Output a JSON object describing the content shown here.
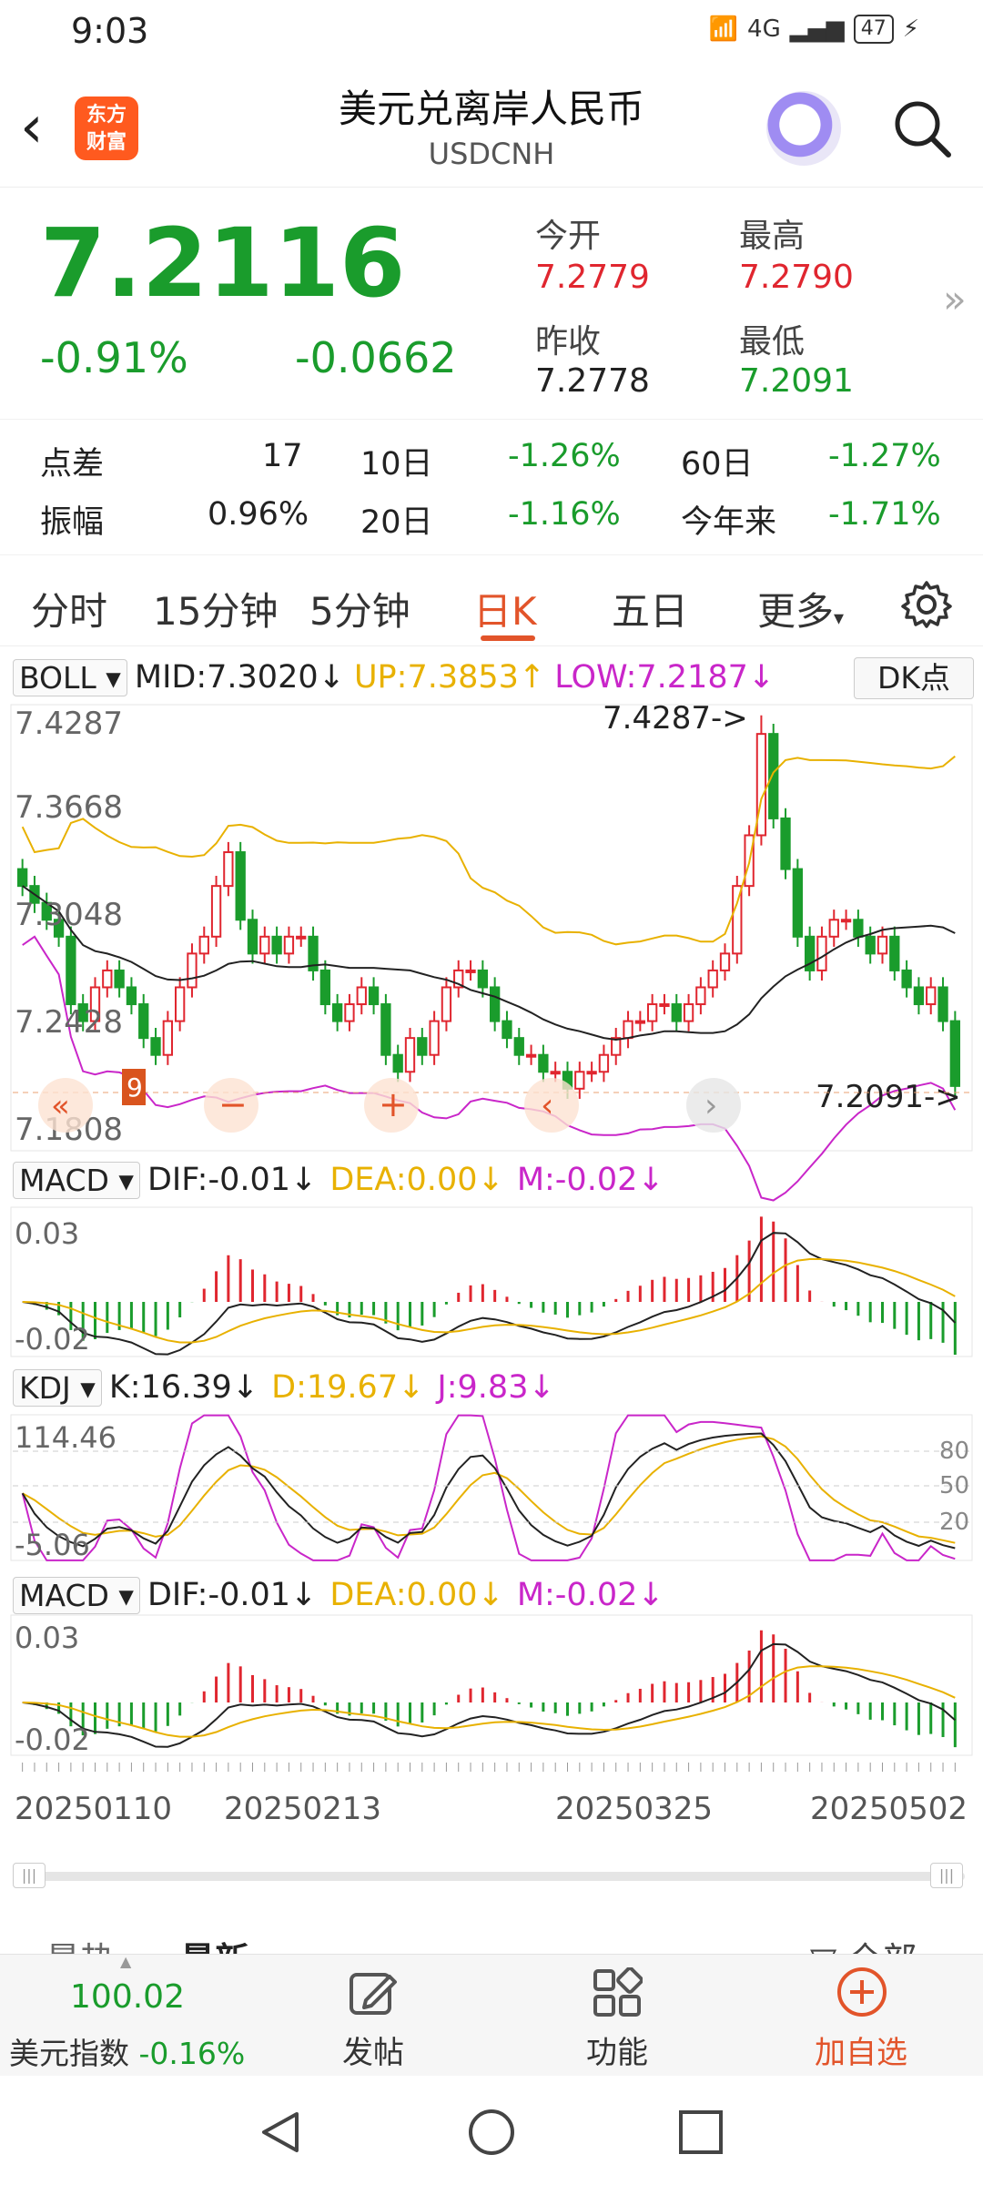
{
  "status_bar": {
    "time": "9:03",
    "signal": "4G",
    "battery": "47"
  },
  "header": {
    "title": "美元兑离岸人民币",
    "subtitle": "USDCNH",
    "logo_text_1": "东方",
    "logo_text_2": "财富"
  },
  "quote": {
    "price": "7.2116",
    "change_pct": "-0.91%",
    "change": "-0.0662",
    "open_label": "今开",
    "open": "7.2779",
    "high_label": "最高",
    "high": "7.2790",
    "prev_close_label": "昨收",
    "prev_close": "7.2778",
    "low_label": "最低",
    "low": "7.2091"
  },
  "stats": {
    "spread_label": "点差",
    "spread": "17",
    "amplitude_label": "振幅",
    "amplitude": "0.96%",
    "d10_label": "10日",
    "d10": "-1.26%",
    "d20_label": "20日",
    "d20": "-1.16%",
    "d60_label": "60日",
    "d60": "-1.27%",
    "ytd_label": "今年来",
    "ytd": "-1.71%"
  },
  "tabs": [
    "分时",
    "15分钟",
    "5分钟",
    "日K",
    "五日",
    "更多"
  ],
  "active_tab": "日K",
  "boll": {
    "name": "BOLL",
    "mid": "MID:7.3020",
    "up": "UP:7.3853",
    "low": "LOW:7.2187",
    "dk": "DK点"
  },
  "macd1": {
    "name": "MACD",
    "dif": "DIF:-0.01",
    "dea": "DEA:0.00",
    "m": "M:-0.02"
  },
  "kdj": {
    "name": "KDJ",
    "k": "K:16.39",
    "d": "D:19.67",
    "j": "J:9.83"
  },
  "macd2": {
    "name": "MACD",
    "dif": "DIF:-0.01",
    "dea": "DEA:0.00",
    "m": "M:-0.02"
  },
  "chart_labels": {
    "boll_y": [
      "7.4287",
      "7.3668",
      "7.3048",
      "7.2428",
      "7.1808"
    ],
    "high_marker": "7.4287->",
    "low_marker": "7.2091->",
    "macd_y": [
      "0.03",
      "-0.02"
    ],
    "kdj_y": [
      "114.46",
      "-5.06"
    ],
    "kdj_levels": [
      "80",
      "50",
      "20"
    ],
    "dates": [
      "20250110",
      "20250213",
      "20250325",
      "20250502"
    ],
    "tag_nine": "9"
  },
  "colors": {
    "up": "#e0262f",
    "down": "#1a9c2c",
    "accent": "#e2542a",
    "yellow": "#e8b100",
    "magenta": "#c926c9"
  },
  "comments": {
    "hot": "最热",
    "latest": "最新",
    "all": "全部"
  },
  "toolbar": {
    "index_value": "100.02",
    "index_name": "美元指数",
    "index_change": "-0.16%",
    "post": "发帖",
    "function": "功能",
    "add": "加自选"
  },
  "chart_data": {
    "type": "candlestick",
    "title": "USDCNH 日K",
    "ylim": [
      7.1808,
      7.4287
    ],
    "x_ticks": [
      "20250110",
      "20250213",
      "20250325",
      "20250502"
    ],
    "close_series_approx": [
      7.33,
      7.32,
      7.31,
      7.3,
      7.26,
      7.25,
      7.27,
      7.28,
      7.27,
      7.26,
      7.24,
      7.23,
      7.25,
      7.27,
      7.29,
      7.3,
      7.33,
      7.35,
      7.31,
      7.29,
      7.3,
      7.29,
      7.3,
      7.3,
      7.28,
      7.26,
      7.25,
      7.26,
      7.27,
      7.26,
      7.23,
      7.22,
      7.24,
      7.23,
      7.25,
      7.27,
      7.28,
      7.28,
      7.27,
      7.25,
      7.24,
      7.23,
      7.23,
      7.22,
      7.22,
      7.21,
      7.22,
      7.22,
      7.23,
      7.24,
      7.25,
      7.25,
      7.26,
      7.26,
      7.25,
      7.26,
      7.27,
      7.28,
      7.29,
      7.33,
      7.36,
      7.42,
      7.37,
      7.34,
      7.3,
      7.28,
      7.3,
      7.31,
      7.31,
      7.3,
      7.29,
      7.3,
      7.28,
      7.27,
      7.26,
      7.27,
      7.25,
      7.2116
    ],
    "macd": {
      "dif": "-0.01",
      "dea": "0.00",
      "m": "-0.02"
    },
    "kdj": {
      "k": 16.39,
      "d": 19.67,
      "j": 9.83
    }
  }
}
